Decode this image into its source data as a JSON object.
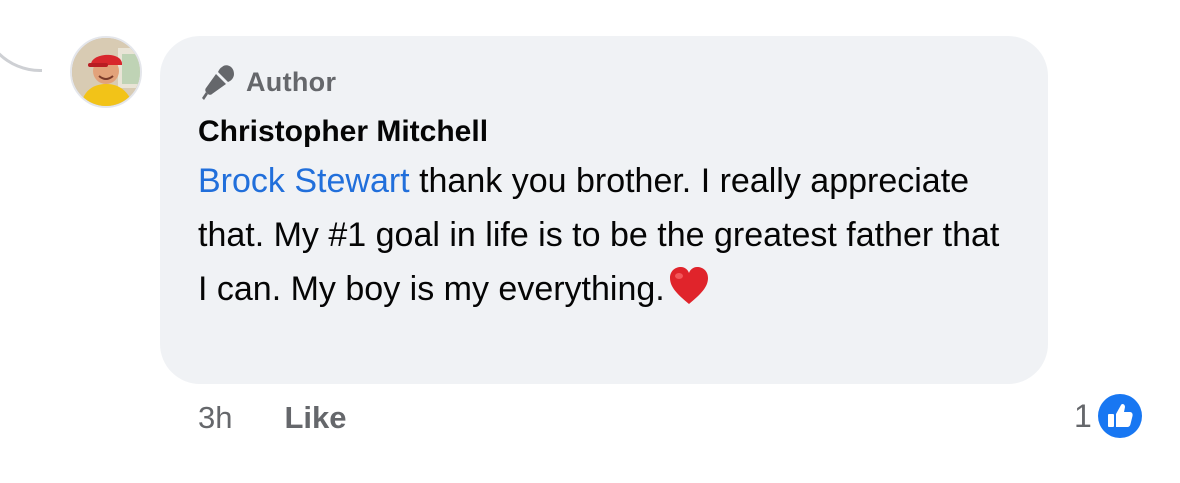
{
  "comment": {
    "badge_label": "Author",
    "author_name": "Christopher Mitchell",
    "mention": "Brock Stewart",
    "text": " thank you brother. I really appreciate that. My #1 goal in life is to be the greatest father that I can. My boy is my everything.",
    "emoji": "red-heart",
    "time": "3h",
    "like_label": "Like",
    "reaction_count": "1",
    "reaction_type": "like",
    "colors": {
      "bubble": "#f0f2f5",
      "mention": "#216fdb",
      "secondary_text": "#65676b",
      "like_blue": "#1877f2",
      "heart": "#e0242b"
    }
  }
}
